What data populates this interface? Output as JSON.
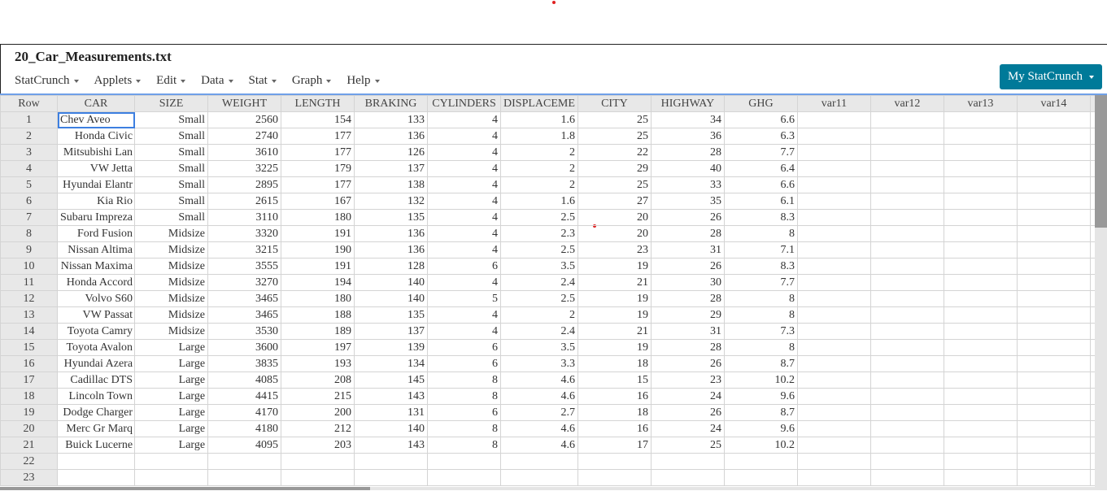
{
  "window": {
    "title": "20_Car_Measurements.txt"
  },
  "menubar": {
    "items": [
      {
        "label": "StatCrunch"
      },
      {
        "label": "Applets"
      },
      {
        "label": "Edit"
      },
      {
        "label": "Data"
      },
      {
        "label": "Stat"
      },
      {
        "label": "Graph"
      },
      {
        "label": "Help"
      }
    ]
  },
  "account_button": {
    "label": "My StatCrunch",
    "color": "#007a99"
  },
  "table": {
    "columns": [
      "Row",
      "CAR",
      "SIZE",
      "WEIGHT",
      "LENGTH",
      "BRAKING",
      "CYLINDERS",
      "DISPLACEME",
      "CITY",
      "HIGHWAY",
      "GHG",
      "var11",
      "var12",
      "var13",
      "var14"
    ],
    "selected_cell": {
      "row": 1,
      "column": "CAR"
    },
    "rows": [
      [
        "1",
        "Chev Aveo",
        "Small",
        "2560",
        "154",
        "133",
        "4",
        "1.6",
        "25",
        "34",
        "6.6"
      ],
      [
        "2",
        "Honda Civic",
        "Small",
        "2740",
        "177",
        "136",
        "4",
        "1.8",
        "25",
        "36",
        "6.3"
      ],
      [
        "3",
        "Mitsubishi Lan",
        "Small",
        "3610",
        "177",
        "126",
        "4",
        "2",
        "22",
        "28",
        "7.7"
      ],
      [
        "4",
        "VW Jetta",
        "Small",
        "3225",
        "179",
        "137",
        "4",
        "2",
        "29",
        "40",
        "6.4"
      ],
      [
        "5",
        "Hyundai Elantr",
        "Small",
        "2895",
        "177",
        "138",
        "4",
        "2",
        "25",
        "33",
        "6.6"
      ],
      [
        "6",
        "Kia Rio",
        "Small",
        "2615",
        "167",
        "132",
        "4",
        "1.6",
        "27",
        "35",
        "6.1"
      ],
      [
        "7",
        "Subaru Impreza",
        "Small",
        "3110",
        "180",
        "135",
        "4",
        "2.5",
        "20",
        "26",
        "8.3"
      ],
      [
        "8",
        "Ford Fusion",
        "Midsize",
        "3320",
        "191",
        "136",
        "4",
        "2.3",
        "20",
        "28",
        "8"
      ],
      [
        "9",
        "Nissan Altima",
        "Midsize",
        "3215",
        "190",
        "136",
        "4",
        "2.5",
        "23",
        "31",
        "7.1"
      ],
      [
        "10",
        "Nissan Maxima",
        "Midsize",
        "3555",
        "191",
        "128",
        "6",
        "3.5",
        "19",
        "26",
        "8.3"
      ],
      [
        "11",
        "Honda Accord",
        "Midsize",
        "3270",
        "194",
        "140",
        "4",
        "2.4",
        "21",
        "30",
        "7.7"
      ],
      [
        "12",
        "Volvo S60",
        "Midsize",
        "3465",
        "180",
        "140",
        "5",
        "2.5",
        "19",
        "28",
        "8"
      ],
      [
        "13",
        "VW Passat",
        "Midsize",
        "3465",
        "188",
        "135",
        "4",
        "2",
        "19",
        "29",
        "8"
      ],
      [
        "14",
        "Toyota Camry",
        "Midsize",
        "3530",
        "189",
        "137",
        "4",
        "2.4",
        "21",
        "31",
        "7.3"
      ],
      [
        "15",
        "Toyota Avalon",
        "Large",
        "3600",
        "197",
        "139",
        "6",
        "3.5",
        "19",
        "28",
        "8"
      ],
      [
        "16",
        "Hyundai Azera",
        "Large",
        "3835",
        "193",
        "134",
        "6",
        "3.3",
        "18",
        "26",
        "8.7"
      ],
      [
        "17",
        "Cadillac DTS",
        "Large",
        "4085",
        "208",
        "145",
        "8",
        "4.6",
        "15",
        "23",
        "10.2"
      ],
      [
        "18",
        "Lincoln Town",
        "Large",
        "4415",
        "215",
        "143",
        "8",
        "4.6",
        "16",
        "24",
        "9.6"
      ],
      [
        "19",
        "Dodge Charger",
        "Large",
        "4170",
        "200",
        "131",
        "6",
        "2.7",
        "18",
        "26",
        "8.7"
      ],
      [
        "20",
        "Merc Gr Marq",
        "Large",
        "4180",
        "212",
        "140",
        "8",
        "4.6",
        "16",
        "24",
        "9.6"
      ],
      [
        "21",
        "Buick Lucerne",
        "Large",
        "4095",
        "203",
        "143",
        "8",
        "4.6",
        "17",
        "25",
        "10.2"
      ],
      [
        "22"
      ],
      [
        "23"
      ]
    ]
  }
}
